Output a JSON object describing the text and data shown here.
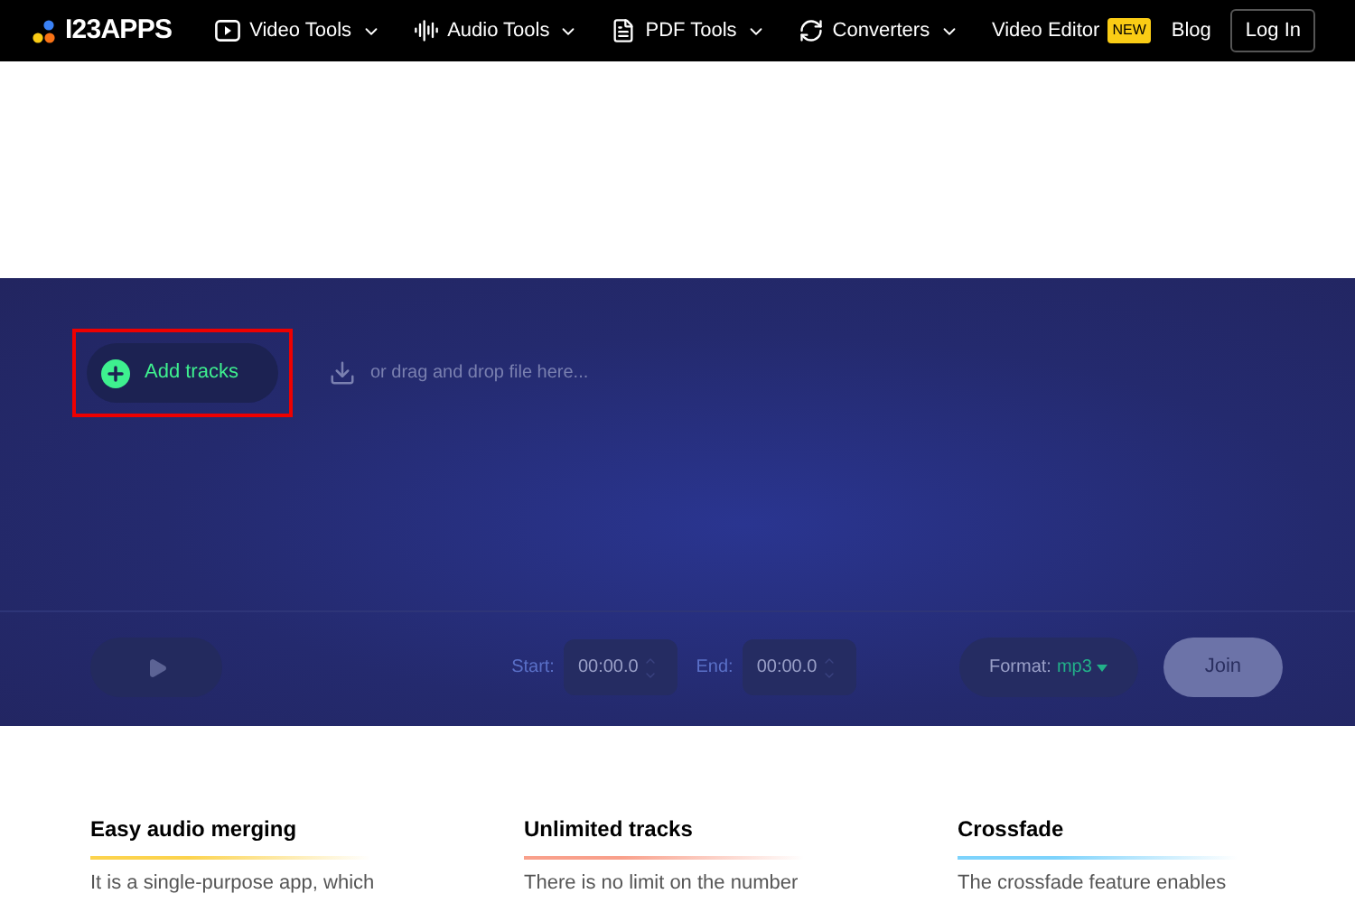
{
  "header": {
    "logo": "I23APPS",
    "nav": [
      {
        "label": "Video Tools",
        "kind": "video"
      },
      {
        "label": "Audio Tools",
        "kind": "audio"
      },
      {
        "label": "PDF Tools",
        "kind": "pdf"
      },
      {
        "label": "Converters",
        "kind": "convert"
      }
    ],
    "video_editor": "Video Editor",
    "new_badge": "NEW",
    "blog": "Blog",
    "login": "Log In"
  },
  "uploader": {
    "add_button": "Add tracks",
    "highlighted": true,
    "drop_hint": "or drag and drop file here..."
  },
  "controls": {
    "start_label": "Start:",
    "start_value": "00:00.0",
    "end_label": "End:",
    "end_value": "00:00.0",
    "format_label": "Format:",
    "format_value": "mp3",
    "join": "Join"
  },
  "features": [
    {
      "title": "Easy audio merging",
      "color": "#fcd34d",
      "text": "It is a single-purpose app, which"
    },
    {
      "title": "Unlimited tracks",
      "color": "#f9a08b",
      "text": "There is no limit on the number"
    },
    {
      "title": "Crossfade",
      "color": "#7dd3fc",
      "text": "The crossfade feature enables"
    }
  ]
}
